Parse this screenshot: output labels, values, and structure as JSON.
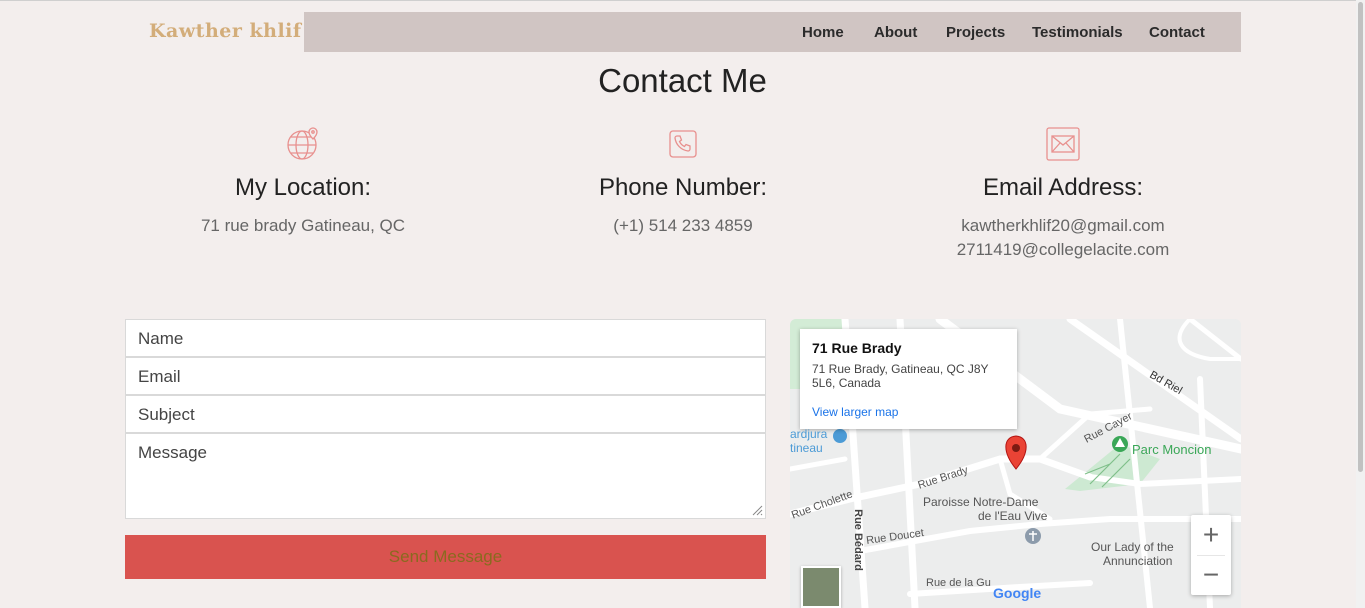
{
  "header": {
    "logo": "Kawther khlif",
    "nav": [
      "Home",
      "About",
      "Projects",
      "Testimonials",
      "Contact"
    ]
  },
  "contact": {
    "title": "Contact Me",
    "location": {
      "heading": "My Location:",
      "lines": [
        "71 rue brady Gatineau, QC"
      ]
    },
    "phone": {
      "heading": "Phone Number:",
      "lines": [
        "(+1) 514 233 4859"
      ]
    },
    "email": {
      "heading": "Email Address:",
      "lines": [
        "kawtherkhlif20@gmail.com",
        "2711419@collegelacite.com"
      ]
    }
  },
  "form": {
    "name_placeholder": "Name",
    "email_placeholder": "Email",
    "subject_placeholder": "Subject",
    "message_placeholder": "Message",
    "send_label": "Send Message"
  },
  "map": {
    "card_title": "71 Rue Brady",
    "card_address": "71 Rue Brady, Gatineau, QC J8Y 5L6, Canada",
    "card_link": "View larger map",
    "labels": {
      "bd_riel": "Bd Riel",
      "rue_cayer": "Rue Cayer",
      "parc_moncion": "Parc Moncion",
      "rue_brady": "Rue Brady",
      "paroisse_1": "Paroisse Notre-Dame",
      "paroisse_2": "de l'Eau Vive",
      "rue_cholette": "Rue Cholette",
      "rue_bedard": "Rue Bédard",
      "rue_doucet": "Rue Doucet",
      "our_lady_1": "Our Lady of the",
      "our_lady_2": "Annunciation",
      "rue_de_la_gu": "Rue de la Gu",
      "gardjura_1": "ardjura",
      "gardjura_2": "tineau",
      "google": "Google"
    },
    "zoom_in": "+",
    "zoom_out": "−"
  },
  "colors": {
    "background": "#f3eeed",
    "navbar": "#d0c5c3",
    "logo": "#d3ad7a",
    "button": "#d9534f",
    "icon": "#e8908e"
  }
}
